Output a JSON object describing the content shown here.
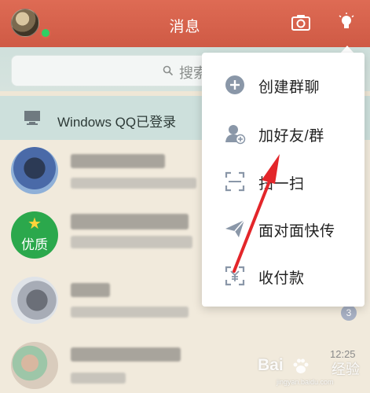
{
  "header": {
    "title": "消息",
    "left_icon": "avatar",
    "status": "online",
    "right_icons": [
      "camera-icon",
      "lightbulb-icon"
    ]
  },
  "search": {
    "placeholder": "搜索"
  },
  "device_bar": {
    "icon": "computer-icon",
    "text": "Windows QQ已登录"
  },
  "conversations": [
    {
      "avatar": "anime-avatar",
      "badge": "",
      "time": ""
    },
    {
      "avatar": "quality-badge-avatar",
      "avatar_text": "优质",
      "badge": "",
      "time": ""
    },
    {
      "avatar": "shark-avatar",
      "badge": "3",
      "time": ""
    },
    {
      "avatar": "cartoon-avatar",
      "badge": "",
      "time": "12:25"
    }
  ],
  "menu": {
    "items": [
      {
        "icon": "create-group-icon",
        "label": "创建群聊"
      },
      {
        "icon": "add-friend-icon",
        "label": "加好友/群"
      },
      {
        "icon": "scan-icon",
        "label": "扫一扫"
      },
      {
        "icon": "send-file-icon",
        "label": "面对面快传"
      },
      {
        "icon": "payment-icon",
        "label": "收付款"
      }
    ]
  },
  "colors": {
    "header": "#d9624c",
    "accent_arrow": "#e3262a",
    "online": "#2fcf63"
  },
  "watermark": {
    "brand": "Bai",
    "brand2": "经验",
    "url": "jingyan.baidu.com"
  }
}
